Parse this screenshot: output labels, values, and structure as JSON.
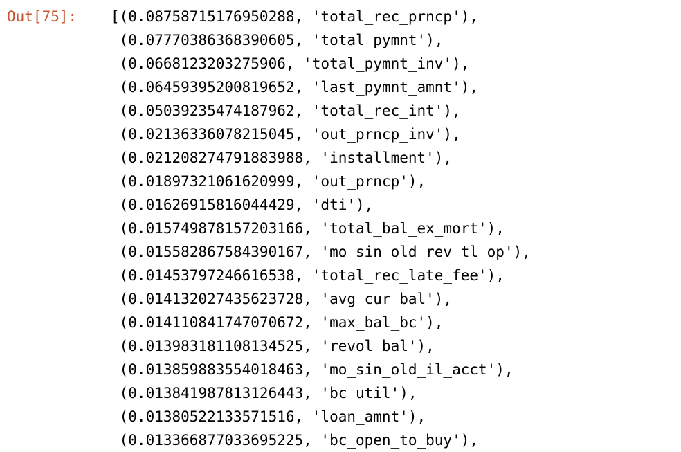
{
  "cell": {
    "prompt": "Out[75]:",
    "lines": [
      "[(0.08758715176950288, 'total_rec_prncp'),",
      " (0.0777038636839060​5, 'total_pymnt'),",
      " (0.0668123203275906, 'total_pymnt_inv'),",
      " (0.06459395200819652, 'last_pymnt_amnt'),",
      " (0.05039235474187962, 'total_rec_int'),",
      " (0.0213633607821504​5, 'out_prncp_inv'),",
      " (0.021208274791883988, 'installment'),",
      " (0.01897321061620999, 'out_prncp'),",
      " (0.01626915816044429, 'dti'),",
      " (0.015749878157203166, 'total_bal_ex_mort'),",
      " (0.015582867584390167, 'mo_sin_old_rev_tl_op'),",
      " (0.01453797246616538, 'total_rec_late_fee'),",
      " (0.014132027435623728, 'avg_cur_bal'),",
      " (0.014110841747070672, 'max_bal_bc'),",
      " (0.013983181108134525, 'revol_bal'),",
      " (0.013859883554018463, 'mo_sin_old_il_acct'),",
      " (0.013841987813126443, 'bc_util'),",
      " (0.01380522133571516, 'loan_amnt'),",
      " (0.013366877033695225, 'bc_open_to_buy'),"
    ]
  },
  "colors": {
    "prompt": "#c7542f",
    "text": "#000000",
    "background": "#ffffff"
  }
}
